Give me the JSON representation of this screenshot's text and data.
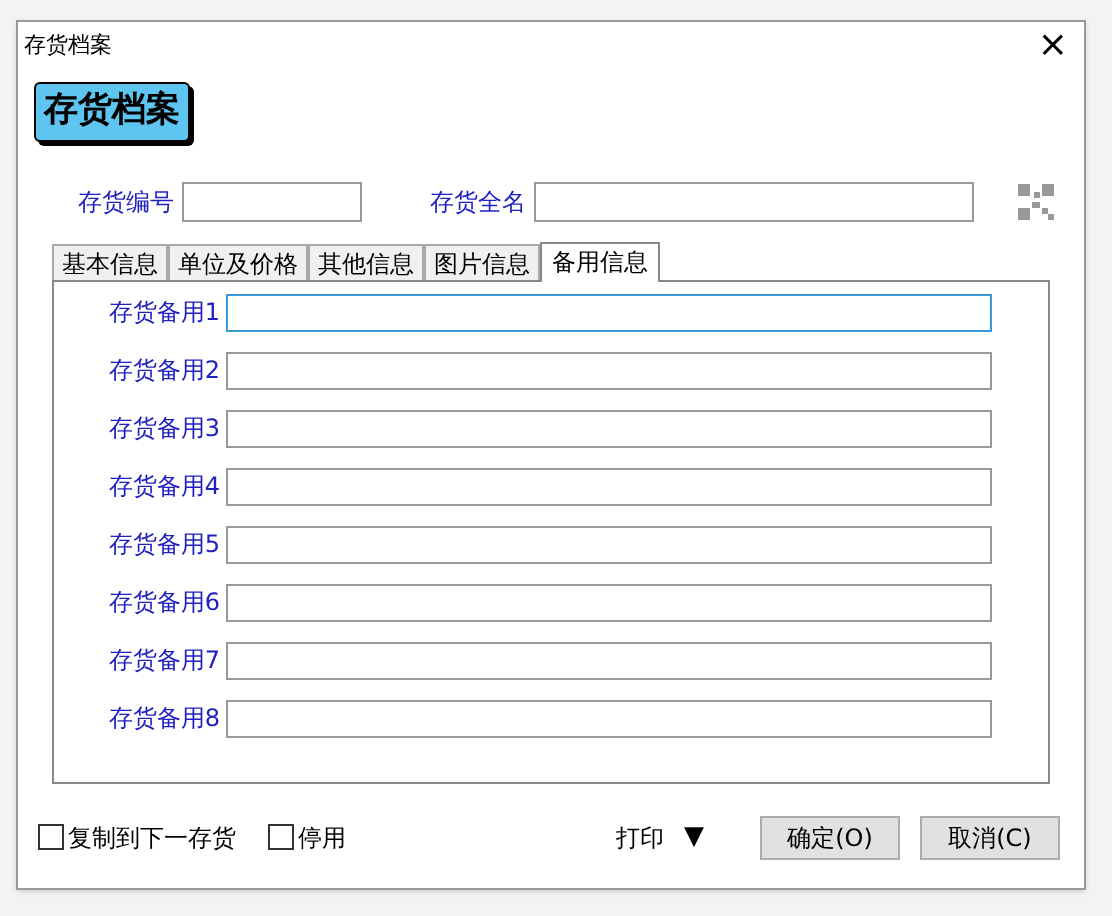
{
  "window": {
    "title": "存货档案",
    "close": "×"
  },
  "header": "存货档案",
  "fields": [
    {
      "label": "存货编号"
    },
    {
      "label": "存货全名"
    }
  ],
  "tabs": [
    {
      "label": "基本信息",
      "selected": false
    },
    {
      "label": "单位及价格",
      "selected": false
    },
    {
      "label": "其他信息",
      "selected": false
    },
    {
      "label": "图片信息",
      "selected": false
    },
    {
      "label": "备用信息",
      "selected": true
    }
  ],
  "spare_fields": [
    {
      "label": "存货备用1",
      "focused": true
    },
    {
      "label": "存货备用2",
      "focused": false
    },
    {
      "label": "存货备用3",
      "focused": false
    },
    {
      "label": "存货备用4",
      "focused": false
    },
    {
      "label": "存货备用5",
      "focused": false
    },
    {
      "label": "存货备用6",
      "focused": false
    },
    {
      "label": "存货备用7",
      "focused": false
    },
    {
      "label": "存货备用8",
      "focused": false
    }
  ],
  "checkboxes": [
    {
      "label": "复制到下一存货",
      "checked": false
    },
    {
      "label": "停用",
      "checked": false
    }
  ],
  "print": {
    "label": "打印",
    "caret": "▼"
  },
  "buttons": [
    "确定(O)",
    "取消(C)"
  ]
}
